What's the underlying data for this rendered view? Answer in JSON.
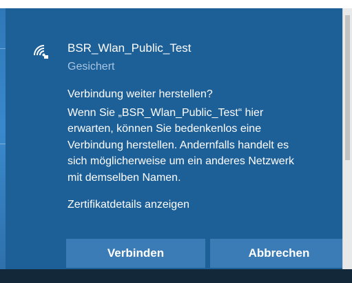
{
  "network": {
    "name": "BSR_Wlan_Public_Test",
    "status": "Gesichert",
    "icon": "wifi-secured-icon"
  },
  "prompt": {
    "question": "Verbindung weiter herstellen?",
    "lines": [
      "Wenn Sie „BSR_Wlan_Public_Test“ hier",
      "erwarten, können Sie bedenkenlos eine",
      "Verbindung herstellen. Andernfalls handelt es",
      "sich möglicherweise um ein anderes Netzwerk",
      "mit demselben Namen."
    ],
    "cert_link": "Zertifikatdetails anzeigen"
  },
  "buttons": {
    "connect_label": "Verbinden",
    "cancel_label": "Abbrechen"
  },
  "colors": {
    "flyout_bg": "#1d5f97",
    "button_bg": "#3c7cb6",
    "status_text": "#a8c7e4",
    "text": "#ffffff"
  }
}
